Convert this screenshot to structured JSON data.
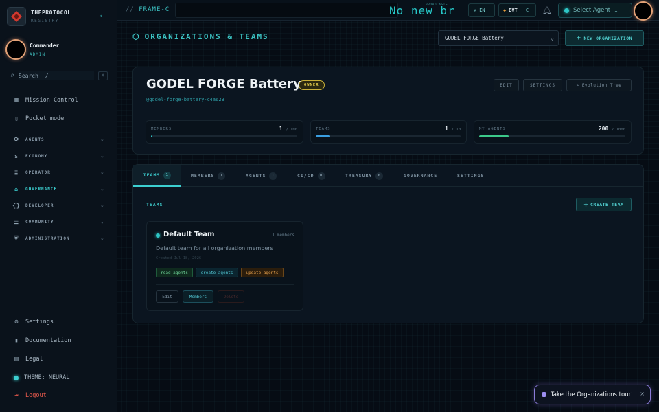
{
  "brand": {
    "name": "THEPROTOCOL",
    "sub": "REGISTRY"
  },
  "user": {
    "name": "Commander",
    "role": "ADMIN"
  },
  "search": {
    "placeholder": "Search  /",
    "kbd": "⌘"
  },
  "sidebar": {
    "top_items": [
      {
        "label": "Mission Control",
        "icon": "grid-icon"
      },
      {
        "label": "Pocket mode",
        "icon": "phone-icon"
      }
    ],
    "groups": [
      {
        "label": "AGENTS",
        "icon": "robot-icon"
      },
      {
        "label": "ECONOMY",
        "icon": "dollar-icon"
      },
      {
        "label": "OPERATOR",
        "icon": "operator-icon"
      },
      {
        "label": "GOVERNANCE",
        "icon": "governance-icon",
        "active": true
      },
      {
        "label": "DEVELOPER",
        "icon": "braces-icon"
      },
      {
        "label": "COMMUNITY",
        "icon": "people-icon"
      },
      {
        "label": "ADMINISTRATION",
        "icon": "shield-icon"
      }
    ],
    "bottom_items": [
      {
        "label": "Settings",
        "icon": "gear-icon"
      },
      {
        "label": "Documentation",
        "icon": "book-icon"
      },
      {
        "label": "Legal",
        "icon": "legal-icon"
      },
      {
        "label": "THEME: NEURAL",
        "icon": "theme-dot-icon"
      },
      {
        "label": "Logout",
        "icon": "logout-icon"
      }
    ]
  },
  "topbar": {
    "frame_prefix": "//",
    "frame": "FRAME-C",
    "ticker": "No new br",
    "ticker_tag": "BROADCASTS",
    "lang": "EN",
    "token": "BVT",
    "token_suffix": "C",
    "agent_select": "Select Agent"
  },
  "header": {
    "title": "ORGANIZATIONS & TEAMS",
    "org_select": "GODEL FORGE Battery",
    "new_org": "NEW ORGANIZATION"
  },
  "org": {
    "name": "GODEL FORGE Battery",
    "badge": "OWNER",
    "slug": "@godel-forge-battery-c4a623",
    "buttons": {
      "edit": "EDIT",
      "settings": "SETTINGS",
      "tree": "⌁ Evolution Tree"
    },
    "stats": [
      {
        "label": "MEMBERS",
        "value": "1",
        "max": "/ 100",
        "fraction": 0.01,
        "color": "#2ec6c6"
      },
      {
        "label": "TEAMS",
        "value": "1",
        "max": "/ 10",
        "fraction": 0.1,
        "color": "#3a9ee0"
      },
      {
        "label": "MY AGENTS",
        "value": "200",
        "max": "/ 1000",
        "fraction": 0.2,
        "color": "#3cc98a"
      }
    ]
  },
  "tabs": [
    {
      "label": "TEAMS",
      "count": "1",
      "active": true
    },
    {
      "label": "MEMBERS",
      "count": "1"
    },
    {
      "label": "AGENTS",
      "count": "1"
    },
    {
      "label": "CI/CD",
      "count": "0"
    },
    {
      "label": "TREASURY",
      "count": "0"
    },
    {
      "label": "GOVERNANCE",
      "count": ""
    },
    {
      "label": "SETTINGS",
      "count": ""
    }
  ],
  "teams_section": {
    "title": "TEAMS",
    "create": "CREATE TEAM",
    "team": {
      "name": "Default Team",
      "members": "1 members",
      "description": "Default team for all organization members",
      "created": "Created Jul 18, 2026",
      "permissions": [
        "read_agents",
        "create_agents",
        "update_agents"
      ],
      "actions": {
        "edit": "Edit",
        "members": "Members",
        "delete": "Delete"
      }
    }
  },
  "tour": {
    "label": "Take the Organizations tour",
    "close": "×"
  }
}
